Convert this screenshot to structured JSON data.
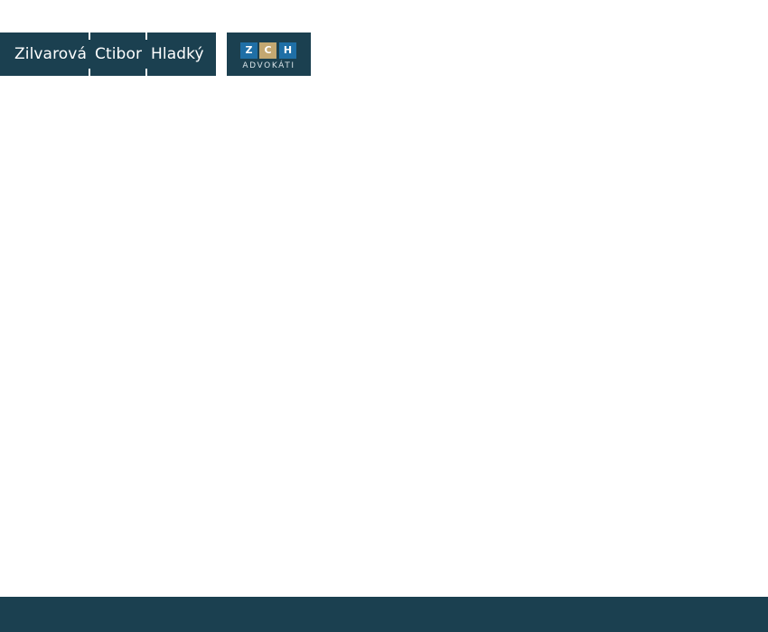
{
  "header": {
    "names": [
      "Zilvarová",
      "Ctibor",
      "Hladký"
    ]
  },
  "logo": {
    "letters": [
      "Z",
      "C",
      "H"
    ],
    "subtitle": "ADVOKÁTI"
  },
  "colors": {
    "brand_dark": "#1b4050",
    "logo_blue": "#1f6fa6",
    "logo_gold": "#c3a771",
    "background": "#ffffff"
  }
}
